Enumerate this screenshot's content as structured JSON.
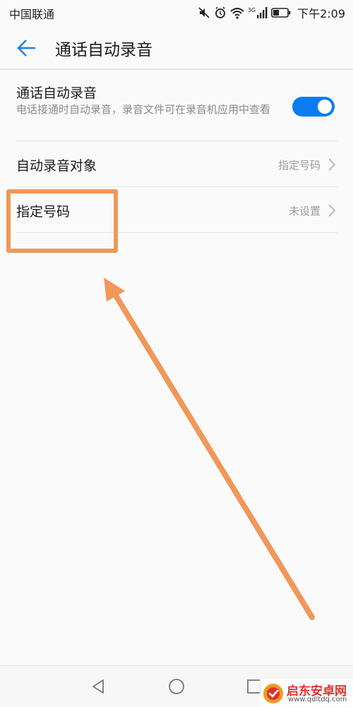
{
  "status_bar": {
    "carrier": "中国联通",
    "network": "3G",
    "time": "下午2:09",
    "icons": [
      "mute-icon",
      "alarm-icon",
      "wifi-icon",
      "signal-icon",
      "battery-icon"
    ]
  },
  "header": {
    "title": "通话自动录音",
    "back_icon": "back-arrow-icon"
  },
  "settings": {
    "auto_record": {
      "title": "通话自动录音",
      "description": "电话接通时自动录音，录音文件可在录音机应用中查看",
      "enabled": true
    },
    "record_target": {
      "title": "自动录音对象",
      "value": "指定号码"
    },
    "specified_numbers": {
      "title": "指定号码",
      "value": "未设置"
    }
  },
  "annotation": {
    "color": "#f0985a",
    "target": "specified_numbers"
  },
  "nav_bar": {
    "buttons": [
      "back-triangle-icon",
      "home-circle-icon",
      "recents-square-icon"
    ]
  },
  "watermark": {
    "name": "启东安卓网",
    "url": "www.qdltdq.com"
  },
  "colors": {
    "accent": "#0a7cf0",
    "annotation": "#f0985a",
    "background": "#fafafa"
  }
}
